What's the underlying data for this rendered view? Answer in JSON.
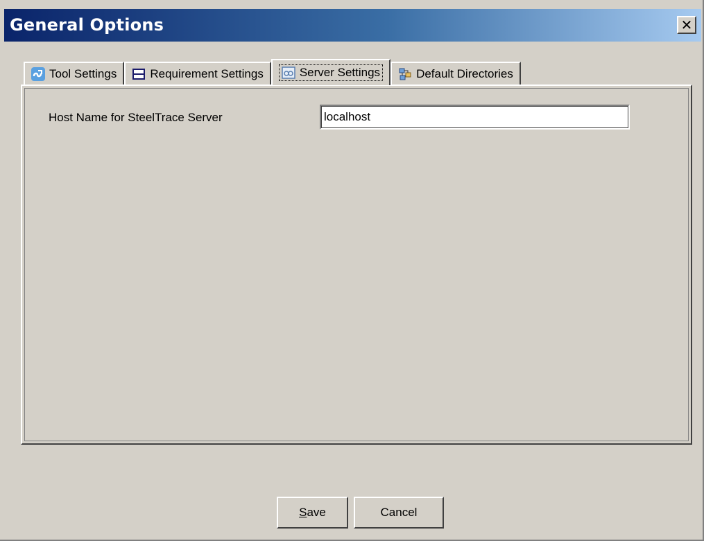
{
  "window": {
    "title": "General Options",
    "close_glyph": "✕"
  },
  "tabs": [
    {
      "label": "Tool Settings",
      "icon": "tool-settings-icon",
      "active": false
    },
    {
      "label": "Requirement Settings",
      "icon": "requirement-settings-icon",
      "active": false
    },
    {
      "label": "Server Settings",
      "icon": "server-settings-icon",
      "active": true
    },
    {
      "label": "Default Directories",
      "icon": "default-directories-icon",
      "active": false
    }
  ],
  "server_settings": {
    "host_label": "Host Name for SteelTrace Server",
    "host_value": "localhost"
  },
  "buttons": {
    "save_mnemonic": "S",
    "save_rest": "ave",
    "cancel_label": "Cancel"
  },
  "colors": {
    "face": "#d4d0c8",
    "title_gradient_start": "#0a246a",
    "title_gradient_end": "#a6caf0"
  }
}
